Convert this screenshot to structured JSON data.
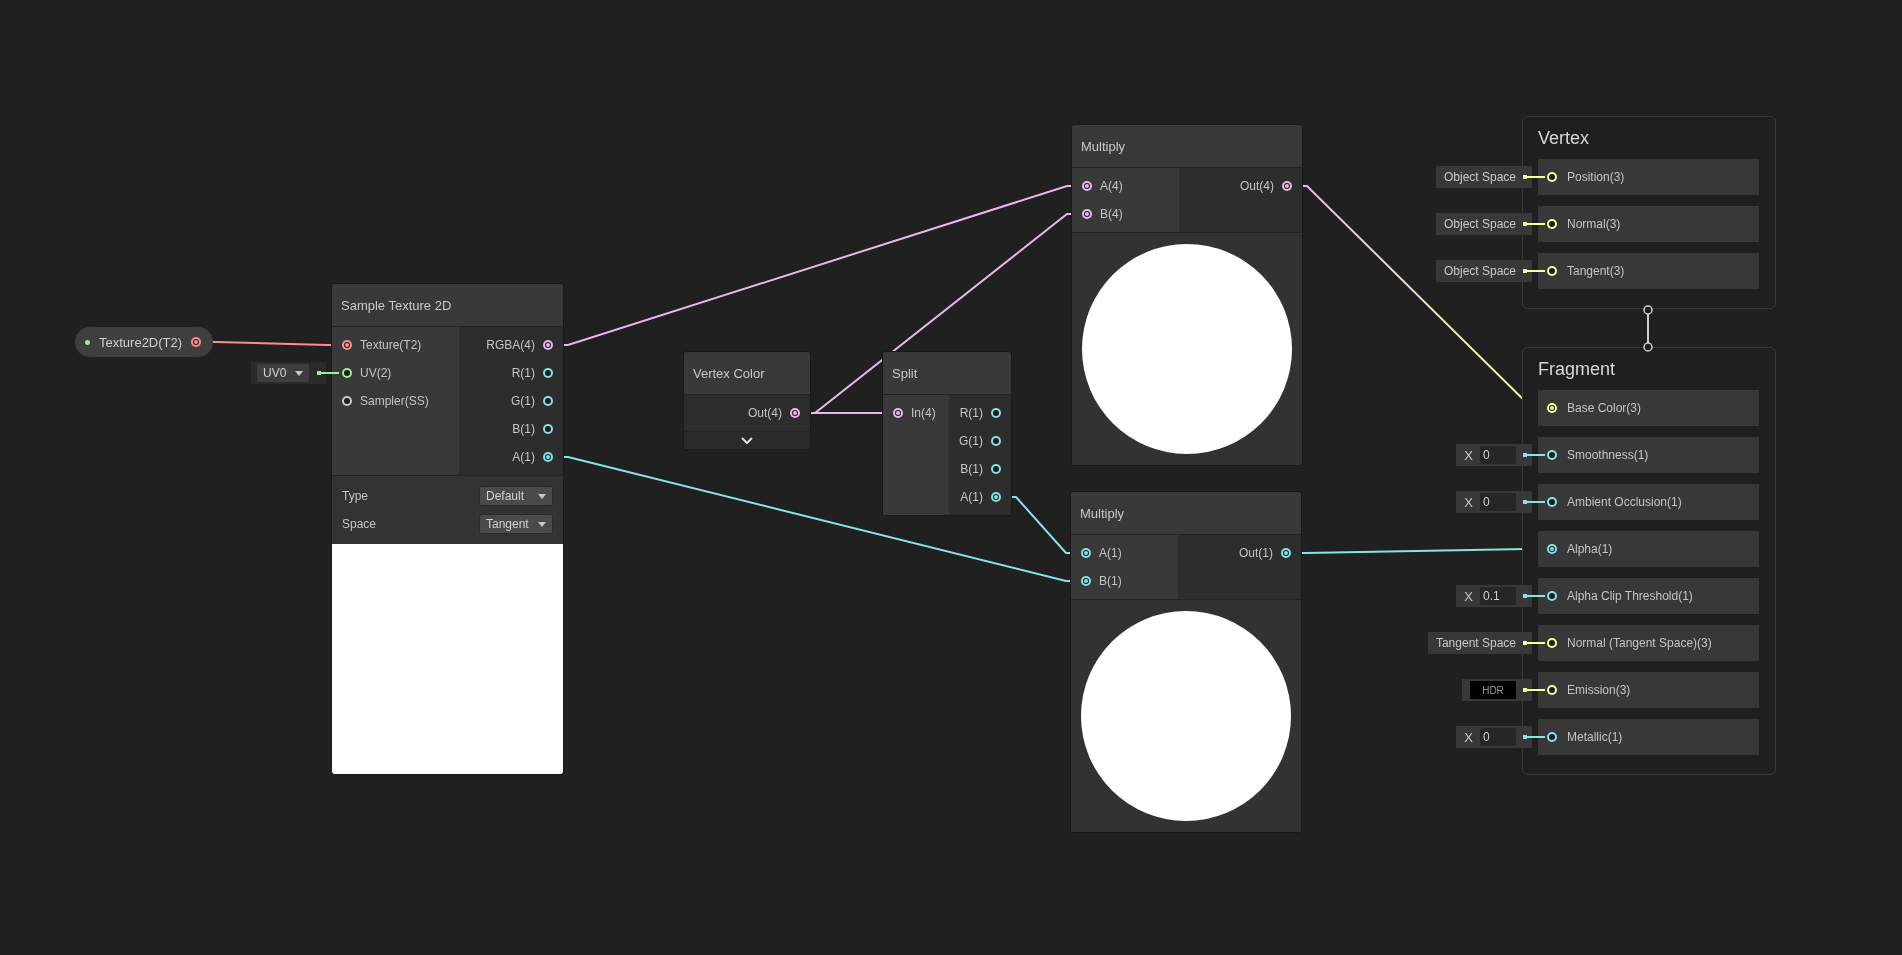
{
  "properties": [
    {
      "label": "Texture2D(T2)",
      "exposed": true,
      "color": "#ff8b8b",
      "connected": true
    }
  ],
  "nodes": [
    {
      "title": "Sample Texture 2D",
      "inputs": [
        {
          "label": "Texture(T2)",
          "color": "#ff8b8b",
          "connected": true
        },
        {
          "label": "UV(2)",
          "color": "#9aef92",
          "connected": false,
          "default": {
            "kind": "dropdown",
            "value": "UV0"
          }
        },
        {
          "label": "Sampler(SS)",
          "color": "#cccccc",
          "connected": false
        }
      ],
      "outputs": [
        {
          "label": "RGBA(4)",
          "color": "#e9b8e8",
          "connected": true
        },
        {
          "label": "R(1)",
          "color": "#84e4e7",
          "connected": false
        },
        {
          "label": "G(1)",
          "color": "#84e4e7",
          "connected": false
        },
        {
          "label": "B(1)",
          "color": "#84e4e7",
          "connected": false
        },
        {
          "label": "A(1)",
          "color": "#84e4e7",
          "connected": true
        }
      ],
      "settings": [
        {
          "label": "Type",
          "value": "Default"
        },
        {
          "label": "Space",
          "value": "Tangent"
        }
      ],
      "kind": "texture"
    },
    {
      "title": "Vertex Color",
      "outputs": [
        {
          "label": "Out(4)",
          "color": "#e9b8e8",
          "connected": true
        }
      ],
      "kind": "collapsed"
    },
    {
      "title": "Split",
      "kind": "plain",
      "inputs": [
        {
          "label": "In(4)",
          "color": "#e9b8e8",
          "connected": true
        }
      ],
      "outputs": [
        {
          "label": "R(1)",
          "color": "#84e4e7",
          "connected": false
        },
        {
          "label": "G(1)",
          "color": "#84e4e7",
          "connected": false
        },
        {
          "label": "B(1)",
          "color": "#84e4e7",
          "connected": false
        },
        {
          "label": "A(1)",
          "color": "#84e4e7",
          "connected": true
        }
      ]
    },
    {
      "title": "Multiply",
      "inputs": [
        {
          "label": "A(4)",
          "color": "#e9b8e8",
          "connected": true
        },
        {
          "label": "B(4)",
          "color": "#e9b8e8",
          "connected": true
        }
      ],
      "outputs": [
        {
          "label": "Out(4)",
          "color": "#e9b8e8",
          "connected": true
        }
      ],
      "kind": "sphere"
    },
    {
      "title": "Multiply",
      "inputs": [
        {
          "label": "A(1)",
          "color": "#84e4e7",
          "connected": true
        },
        {
          "label": "B(1)",
          "color": "#84e4e7",
          "connected": true
        }
      ],
      "outputs": [
        {
          "label": "Out(1)",
          "color": "#84e4e7",
          "connected": true
        }
      ],
      "kind": "sphere"
    }
  ],
  "contexts": [
    {
      "title": "Vertex",
      "blocks": [
        {
          "label": "Position(3)",
          "color": "#f6ff9a",
          "connected": false,
          "default": {
            "kind": "label",
            "value": "Object Space"
          }
        },
        {
          "label": "Normal(3)",
          "color": "#f6ff9a",
          "connected": false,
          "default": {
            "kind": "label",
            "value": "Object Space"
          }
        },
        {
          "label": "Tangent(3)",
          "color": "#f6ff9a",
          "connected": false,
          "default": {
            "kind": "label",
            "value": "Object Space"
          }
        }
      ]
    },
    {
      "title": "Fragment",
      "blocks": [
        {
          "label": "Base Color(3)",
          "color": "#f6ff9a",
          "connected": true
        },
        {
          "label": "Smoothness(1)",
          "color": "#84e4e7",
          "connected": false,
          "default": {
            "kind": "float",
            "axis": "X",
            "value": "0"
          }
        },
        {
          "label": "Ambient Occlusion(1)",
          "color": "#84e4e7",
          "connected": false,
          "default": {
            "kind": "float",
            "axis": "X",
            "value": "0"
          }
        },
        {
          "label": "Alpha(1)",
          "color": "#84e4e7",
          "connected": true
        },
        {
          "label": "Alpha Clip Threshold(1)",
          "color": "#84e4e7",
          "connected": false,
          "default": {
            "kind": "float",
            "axis": "X",
            "value": "0.1"
          }
        },
        {
          "label": "Normal (Tangent Space)(3)",
          "color": "#f6ff9a",
          "connected": false,
          "default": {
            "kind": "label",
            "value": "Tangent Space"
          }
        },
        {
          "label": "Emission(3)",
          "color": "#f6ff9a",
          "connected": false,
          "default": {
            "kind": "color",
            "value": "HDR"
          }
        },
        {
          "label": "Metallic(1)",
          "color": "#84e4e7",
          "connected": false,
          "default": {
            "kind": "float",
            "axis": "X",
            "value": "0"
          }
        }
      ]
    }
  ]
}
